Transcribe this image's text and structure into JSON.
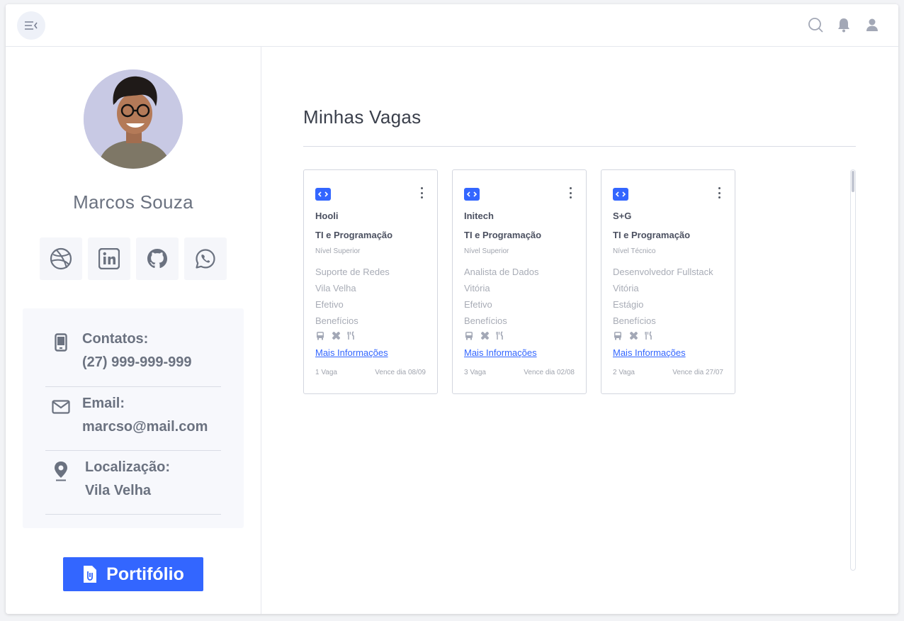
{
  "colors": {
    "accent": "#3366ff",
    "text_muted": "#6b7280",
    "border": "#d3d6df"
  },
  "topbar": {
    "menu_icon": "menu-collapse-icon",
    "icons": [
      "search-icon",
      "bell-icon",
      "user-icon"
    ]
  },
  "profile": {
    "name": "Marcos Souza",
    "socials": [
      "dribbble-icon",
      "linkedin-icon",
      "github-icon",
      "whatsapp-icon"
    ],
    "contacts": [
      {
        "icon": "phone-icon",
        "label": "Contatos:",
        "value": "(27) 999-999-999"
      },
      {
        "icon": "mail-icon",
        "label": "Email:",
        "value": "marcso@mail.com"
      },
      {
        "icon": "location-pin-icon",
        "label": "Localização:",
        "value": "Vila Velha"
      }
    ],
    "portfolio_label": "Portifólio"
  },
  "main": {
    "title": "Minhas Vagas",
    "jobs": [
      {
        "company": "Hooli",
        "area": "TI e Programação",
        "level": "Nível Superior",
        "role": "Suporte de Redes",
        "city": "Vila Velha",
        "contract": "Efetivo",
        "benefits_label": "Benefícios",
        "benefit_icons": [
          "bus-icon",
          "health-icon",
          "meal-icon"
        ],
        "more_label": "Mais Informações",
        "openings": "1 Vaga",
        "due": "Vence dia 08/09"
      },
      {
        "company": "Initech",
        "area": "TI e Programação",
        "level": "Nível Superior",
        "role": "Analista de Dados",
        "city": "Vitória",
        "contract": "Efetivo",
        "benefits_label": "Benefícios",
        "benefit_icons": [
          "bus-icon",
          "health-icon",
          "meal-icon"
        ],
        "more_label": "Mais Informações",
        "openings": "3 Vaga",
        "due": "Vence dia 02/08"
      },
      {
        "company": "S+G",
        "area": "TI e Programação",
        "level": "Nível Técnico",
        "role": "Desenvolvedor Fullstack",
        "city": "Vitória",
        "contract": "Estágio",
        "benefits_label": "Benefícios",
        "benefit_icons": [
          "bus-icon",
          "health-icon",
          "meal-icon"
        ],
        "more_label": "Mais Informações",
        "openings": "2 Vaga",
        "due": "Vence dia 27/07"
      }
    ]
  }
}
